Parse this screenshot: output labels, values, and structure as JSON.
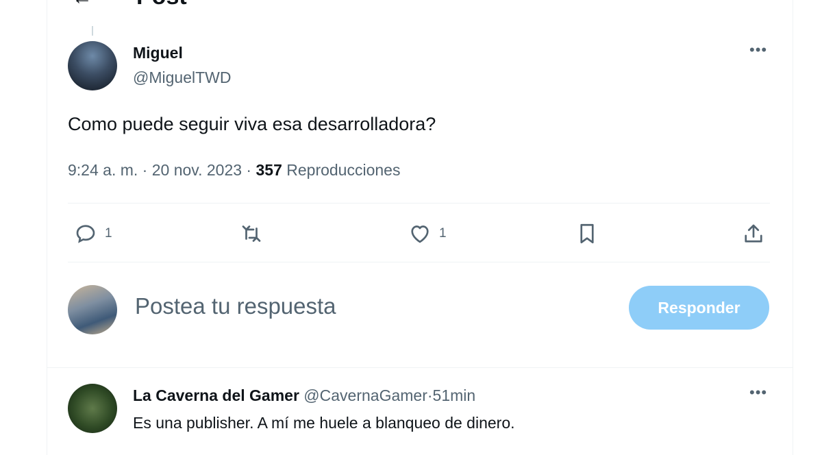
{
  "header": {
    "title": "Post",
    "back_icon": "arrow-left-icon"
  },
  "post": {
    "author_name": "Miguel",
    "author_handle": "@MiguelTWD",
    "text": "Como puede seguir viva esa desarrolladora?",
    "time": "9:24 a. m.",
    "separator": "·",
    "date": "20 nov. 2023",
    "views_count": "357",
    "views_label": "Reproducciones",
    "actions": {
      "reply_count": "1",
      "retweet_count": "",
      "like_count": "1"
    }
  },
  "composer": {
    "placeholder": "Postea tu respuesta",
    "button_label": "Responder",
    "button_color": "#8ecdf8"
  },
  "reply": {
    "author_name": "La Caverna del Gamer",
    "author_handle": "@CavernaGamer",
    "separator": "·",
    "time": "51min",
    "text": "Es una publisher. A mí me huele a blanqueo de dinero."
  },
  "colors": {
    "text_primary": "#0f1419",
    "text_secondary": "#536471",
    "divider": "#eff3f4"
  }
}
